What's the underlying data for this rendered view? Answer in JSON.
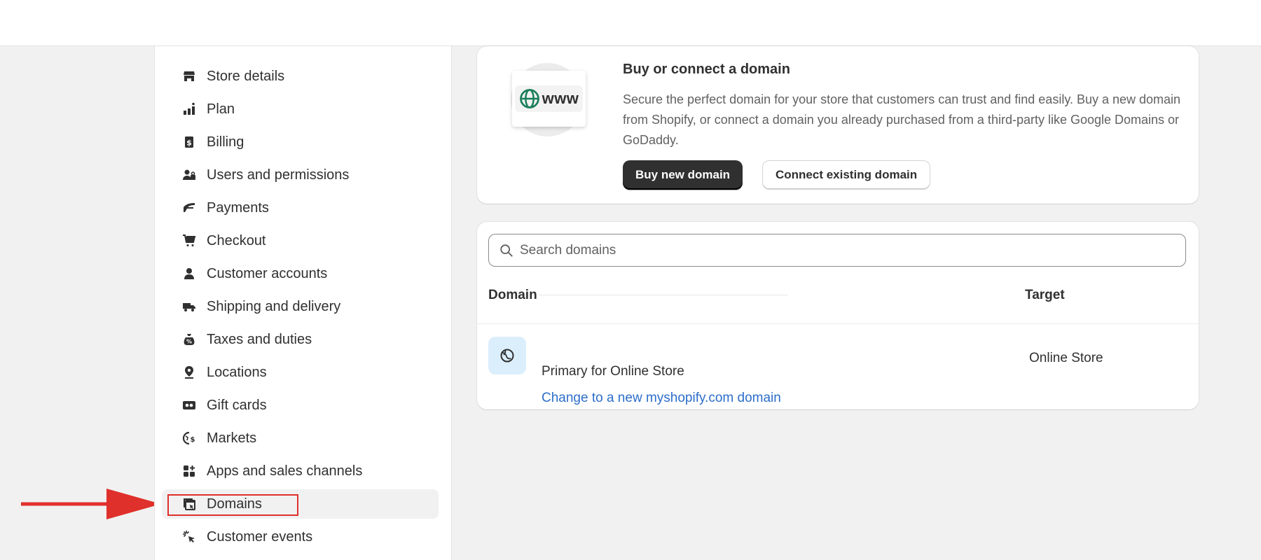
{
  "sidebar": {
    "items": [
      {
        "label": "Store details",
        "icon": "store-icon"
      },
      {
        "label": "Plan",
        "icon": "plan-icon"
      },
      {
        "label": "Billing",
        "icon": "billing-icon"
      },
      {
        "label": "Users and permissions",
        "icon": "users-icon"
      },
      {
        "label": "Payments",
        "icon": "payments-icon"
      },
      {
        "label": "Checkout",
        "icon": "cart-icon"
      },
      {
        "label": "Customer accounts",
        "icon": "person-icon"
      },
      {
        "label": "Shipping and delivery",
        "icon": "truck-icon"
      },
      {
        "label": "Taxes and duties",
        "icon": "tax-bag-icon"
      },
      {
        "label": "Locations",
        "icon": "location-pin-icon"
      },
      {
        "label": "Gift cards",
        "icon": "gift-card-icon"
      },
      {
        "label": "Markets",
        "icon": "globe-dollar-icon"
      },
      {
        "label": "Apps and sales channels",
        "icon": "apps-icon"
      },
      {
        "label": "Domains",
        "icon": "domains-icon",
        "active": true
      },
      {
        "label": "Customer events",
        "icon": "cursor-click-icon"
      }
    ]
  },
  "promo": {
    "illustration_text": "www",
    "title": "Buy or connect a domain",
    "description": "Secure the perfect domain for your store that customers can trust and find easily. Buy a new domain from Shopify, or connect a domain you already purchased from a third-party like Google Domains or GoDaddy.",
    "buy_button": "Buy new domain",
    "connect_button": "Connect existing domain"
  },
  "domains": {
    "search_placeholder": "Search domains",
    "columns": {
      "domain": "Domain",
      "target": "Target"
    },
    "rows": [
      {
        "subtitle": "Primary for Online Store",
        "link": "Change to a new myshopify.com domain",
        "target": "Online Store"
      }
    ]
  },
  "colors": {
    "accent_link": "#2c6ecb",
    "primary_button": "#303030",
    "highlight_annotation": "#e0302b"
  }
}
